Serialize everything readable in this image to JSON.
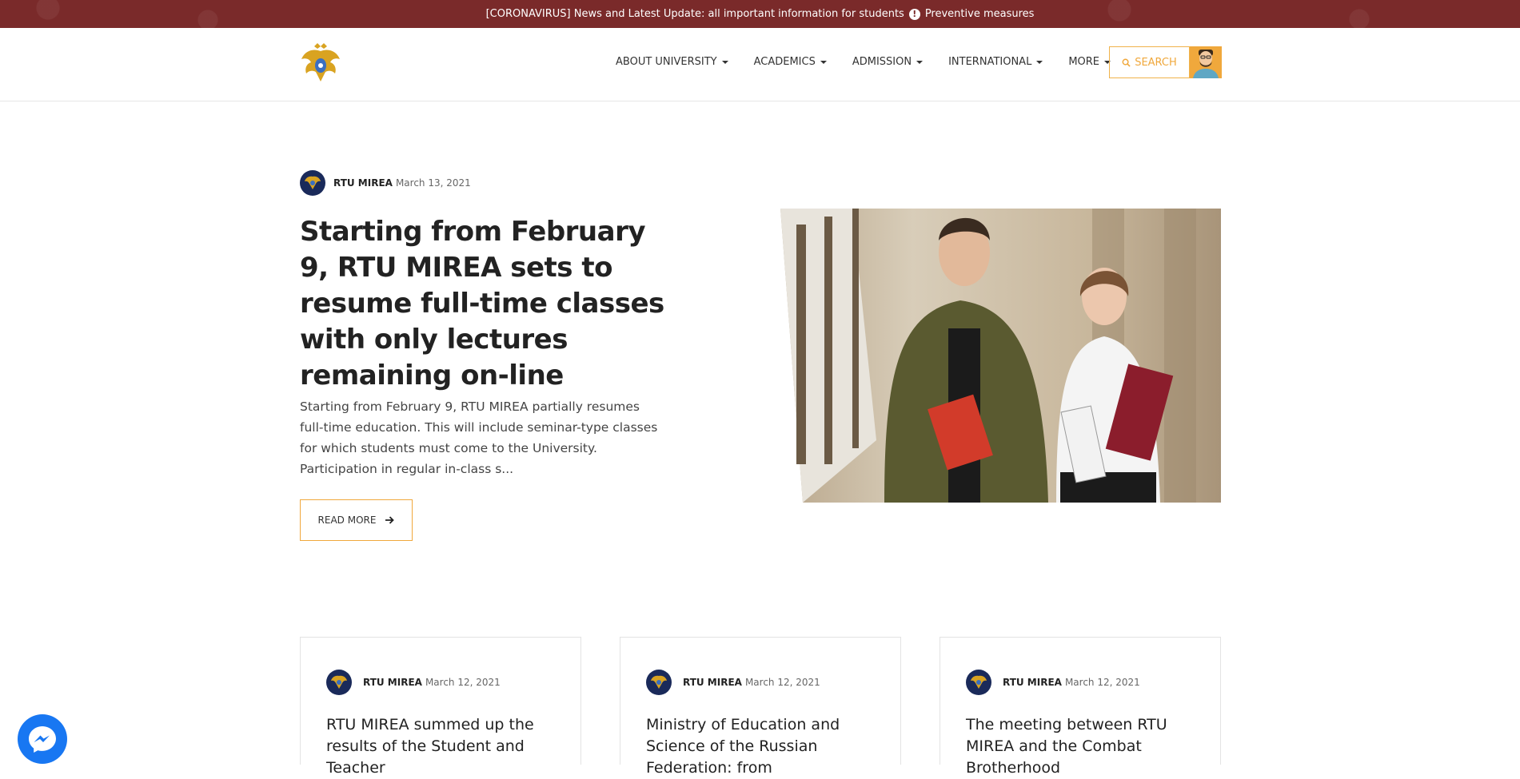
{
  "announcement": {
    "text": "[CORONAVIRUS] News and Latest Update: all important information for students",
    "link": "Preventive measures"
  },
  "nav": {
    "items": [
      "ABOUT UNIVERSITY",
      "ACADEMICS",
      "ADMISSION",
      "INTERNATIONAL",
      "MORE"
    ],
    "search_label": "SEARCH"
  },
  "hero": {
    "author": "RTU MIREA",
    "date": "March 13, 2021",
    "title": "Starting from February 9, RTU MIREA sets to resume full-time classes with only lectures remaining on-line",
    "excerpt": "Starting from February 9, RTU MIREA partially resumes full-time education. This will include seminar-type classes for which students must come to the University. Participation in regular in-class s...",
    "read_more": "READ MORE"
  },
  "cards": [
    {
      "author": "RTU MIREA",
      "date": "March 12, 2021",
      "title": "RTU MIREA summed up the results of the Student and Teacher"
    },
    {
      "author": "RTU MIREA",
      "date": "March 12, 2021",
      "title": "Ministry of Education and Science of the Russian Federation: from"
    },
    {
      "author": "RTU MIREA",
      "date": "March 12, 2021",
      "title": "The meeting between RTU MIREA and the Combat Brotherhood"
    }
  ],
  "colors": {
    "topbar": "#7a2a2a",
    "accent": "#f0a83c",
    "messenger": "#1877f2"
  }
}
